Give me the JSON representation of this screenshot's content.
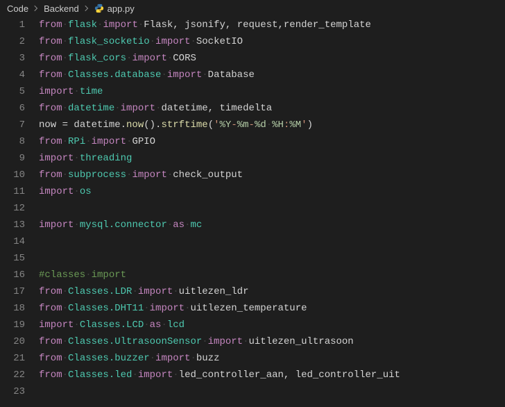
{
  "breadcrumbs": {
    "items": [
      "Code",
      "Backend",
      "app.py"
    ]
  },
  "file_icon": "python-icon",
  "code_lines": [
    {
      "n": 1,
      "tokens": [
        {
          "t": "from",
          "c": "kw"
        },
        {
          "t": "·",
          "c": "ws"
        },
        {
          "t": "flask",
          "c": "mod"
        },
        {
          "t": "·",
          "c": "ws"
        },
        {
          "t": "import",
          "c": "kw"
        },
        {
          "t": "·",
          "c": "ws"
        },
        {
          "t": "Flask, jsonify, request,render_template",
          "c": "id"
        }
      ]
    },
    {
      "n": 2,
      "tokens": [
        {
          "t": "from",
          "c": "kw"
        },
        {
          "t": "·",
          "c": "ws"
        },
        {
          "t": "flask_socketio",
          "c": "mod"
        },
        {
          "t": "·",
          "c": "ws"
        },
        {
          "t": "import",
          "c": "kw"
        },
        {
          "t": "·",
          "c": "ws"
        },
        {
          "t": "SocketIO",
          "c": "id"
        }
      ]
    },
    {
      "n": 3,
      "tokens": [
        {
          "t": "from",
          "c": "kw"
        },
        {
          "t": "·",
          "c": "ws"
        },
        {
          "t": "flask_cors",
          "c": "mod"
        },
        {
          "t": "·",
          "c": "ws"
        },
        {
          "t": "import",
          "c": "kw"
        },
        {
          "t": "·",
          "c": "ws"
        },
        {
          "t": "CORS",
          "c": "id"
        }
      ]
    },
    {
      "n": 4,
      "tokens": [
        {
          "t": "from",
          "c": "kw"
        },
        {
          "t": "·",
          "c": "ws"
        },
        {
          "t": "Classes.database",
          "c": "mod"
        },
        {
          "t": "·",
          "c": "ws"
        },
        {
          "t": "import",
          "c": "kw"
        },
        {
          "t": "·",
          "c": "ws"
        },
        {
          "t": "Database",
          "c": "id"
        }
      ]
    },
    {
      "n": 5,
      "tokens": [
        {
          "t": "import",
          "c": "kw"
        },
        {
          "t": "·",
          "c": "ws"
        },
        {
          "t": "time",
          "c": "mod"
        }
      ]
    },
    {
      "n": 6,
      "tokens": [
        {
          "t": "from",
          "c": "kw"
        },
        {
          "t": "·",
          "c": "ws"
        },
        {
          "t": "datetime",
          "c": "mod"
        },
        {
          "t": "·",
          "c": "ws"
        },
        {
          "t": "import",
          "c": "kw"
        },
        {
          "t": "·",
          "c": "ws"
        },
        {
          "t": "datetime, timedelta",
          "c": "id"
        }
      ]
    },
    {
      "n": 7,
      "tokens": [
        {
          "t": "now ",
          "c": "id"
        },
        {
          "t": "=",
          "c": "op"
        },
        {
          "t": " datetime.",
          "c": "id"
        },
        {
          "t": "now",
          "c": "fn"
        },
        {
          "t": "().",
          "c": "punct"
        },
        {
          "t": "strftime",
          "c": "fn"
        },
        {
          "t": "(",
          "c": "punct"
        },
        {
          "t": "'",
          "c": "str"
        },
        {
          "t": "%Y",
          "c": "str2"
        },
        {
          "t": "-",
          "c": "str"
        },
        {
          "t": "%m",
          "c": "str2"
        },
        {
          "t": "-",
          "c": "str"
        },
        {
          "t": "%d",
          "c": "str2"
        },
        {
          "t": "·",
          "c": "ws"
        },
        {
          "t": "%H",
          "c": "str2"
        },
        {
          "t": ":",
          "c": "str"
        },
        {
          "t": "%M",
          "c": "str2"
        },
        {
          "t": "'",
          "c": "str"
        },
        {
          "t": ")",
          "c": "punct"
        }
      ]
    },
    {
      "n": 8,
      "tokens": [
        {
          "t": "from",
          "c": "kw"
        },
        {
          "t": "·",
          "c": "ws"
        },
        {
          "t": "RPi",
          "c": "mod"
        },
        {
          "t": "·",
          "c": "ws"
        },
        {
          "t": "import",
          "c": "kw"
        },
        {
          "t": "·",
          "c": "ws"
        },
        {
          "t": "GPIO",
          "c": "id"
        }
      ]
    },
    {
      "n": 9,
      "tokens": [
        {
          "t": "import",
          "c": "kw"
        },
        {
          "t": "·",
          "c": "ws"
        },
        {
          "t": "threading",
          "c": "mod"
        }
      ]
    },
    {
      "n": 10,
      "tokens": [
        {
          "t": "from",
          "c": "kw"
        },
        {
          "t": "·",
          "c": "ws"
        },
        {
          "t": "subprocess",
          "c": "mod"
        },
        {
          "t": "·",
          "c": "ws"
        },
        {
          "t": "import",
          "c": "kw"
        },
        {
          "t": "·",
          "c": "ws"
        },
        {
          "t": "check_output",
          "c": "id"
        }
      ]
    },
    {
      "n": 11,
      "tokens": [
        {
          "t": "import",
          "c": "kw"
        },
        {
          "t": "·",
          "c": "ws"
        },
        {
          "t": "os",
          "c": "mod"
        }
      ]
    },
    {
      "n": 12,
      "tokens": []
    },
    {
      "n": 13,
      "tokens": [
        {
          "t": "import",
          "c": "kw"
        },
        {
          "t": "·",
          "c": "ws"
        },
        {
          "t": "mysql.connector",
          "c": "mod"
        },
        {
          "t": "·",
          "c": "ws"
        },
        {
          "t": "as",
          "c": "kw"
        },
        {
          "t": "·",
          "c": "ws"
        },
        {
          "t": "mc",
          "c": "mod"
        }
      ]
    },
    {
      "n": 14,
      "tokens": []
    },
    {
      "n": 15,
      "tokens": []
    },
    {
      "n": 16,
      "tokens": [
        {
          "t": "#classes",
          "c": "com"
        },
        {
          "t": "·",
          "c": "ws"
        },
        {
          "t": "import",
          "c": "com"
        }
      ]
    },
    {
      "n": 17,
      "tokens": [
        {
          "t": "from",
          "c": "kw"
        },
        {
          "t": "·",
          "c": "ws"
        },
        {
          "t": "Classes.LDR",
          "c": "mod"
        },
        {
          "t": "·",
          "c": "ws"
        },
        {
          "t": "import",
          "c": "kw"
        },
        {
          "t": "·",
          "c": "ws"
        },
        {
          "t": "uitlezen_ldr",
          "c": "id"
        }
      ]
    },
    {
      "n": 18,
      "tokens": [
        {
          "t": "from",
          "c": "kw"
        },
        {
          "t": "·",
          "c": "ws"
        },
        {
          "t": "Classes.DHT11",
          "c": "mod"
        },
        {
          "t": "·",
          "c": "ws"
        },
        {
          "t": "import",
          "c": "kw"
        },
        {
          "t": "·",
          "c": "ws"
        },
        {
          "t": "uitlezen_temperature",
          "c": "id"
        }
      ]
    },
    {
      "n": 19,
      "tokens": [
        {
          "t": "import",
          "c": "kw"
        },
        {
          "t": "·",
          "c": "ws"
        },
        {
          "t": "Classes.LCD",
          "c": "mod"
        },
        {
          "t": "·",
          "c": "ws"
        },
        {
          "t": "as",
          "c": "kw"
        },
        {
          "t": "·",
          "c": "ws"
        },
        {
          "t": "lcd",
          "c": "mod"
        }
      ]
    },
    {
      "n": 20,
      "tokens": [
        {
          "t": "from",
          "c": "kw"
        },
        {
          "t": "·",
          "c": "ws"
        },
        {
          "t": "Classes.UltrasoonSensor",
          "c": "mod"
        },
        {
          "t": "·",
          "c": "ws"
        },
        {
          "t": "import",
          "c": "kw"
        },
        {
          "t": "·",
          "c": "ws"
        },
        {
          "t": "uitlezen_ultrasoon",
          "c": "id"
        }
      ]
    },
    {
      "n": 21,
      "tokens": [
        {
          "t": "from",
          "c": "kw"
        },
        {
          "t": "·",
          "c": "ws"
        },
        {
          "t": "Classes.buzzer",
          "c": "mod"
        },
        {
          "t": "·",
          "c": "ws"
        },
        {
          "t": "import",
          "c": "kw"
        },
        {
          "t": "·",
          "c": "ws"
        },
        {
          "t": "buzz",
          "c": "id"
        }
      ]
    },
    {
      "n": 22,
      "tokens": [
        {
          "t": "from",
          "c": "kw"
        },
        {
          "t": "·",
          "c": "ws"
        },
        {
          "t": "Classes.led",
          "c": "mod"
        },
        {
          "t": "·",
          "c": "ws"
        },
        {
          "t": "import",
          "c": "kw"
        },
        {
          "t": "·",
          "c": "ws"
        },
        {
          "t": "led_controller_aan, led_controller_uit",
          "c": "id"
        }
      ]
    },
    {
      "n": 23,
      "tokens": []
    }
  ]
}
